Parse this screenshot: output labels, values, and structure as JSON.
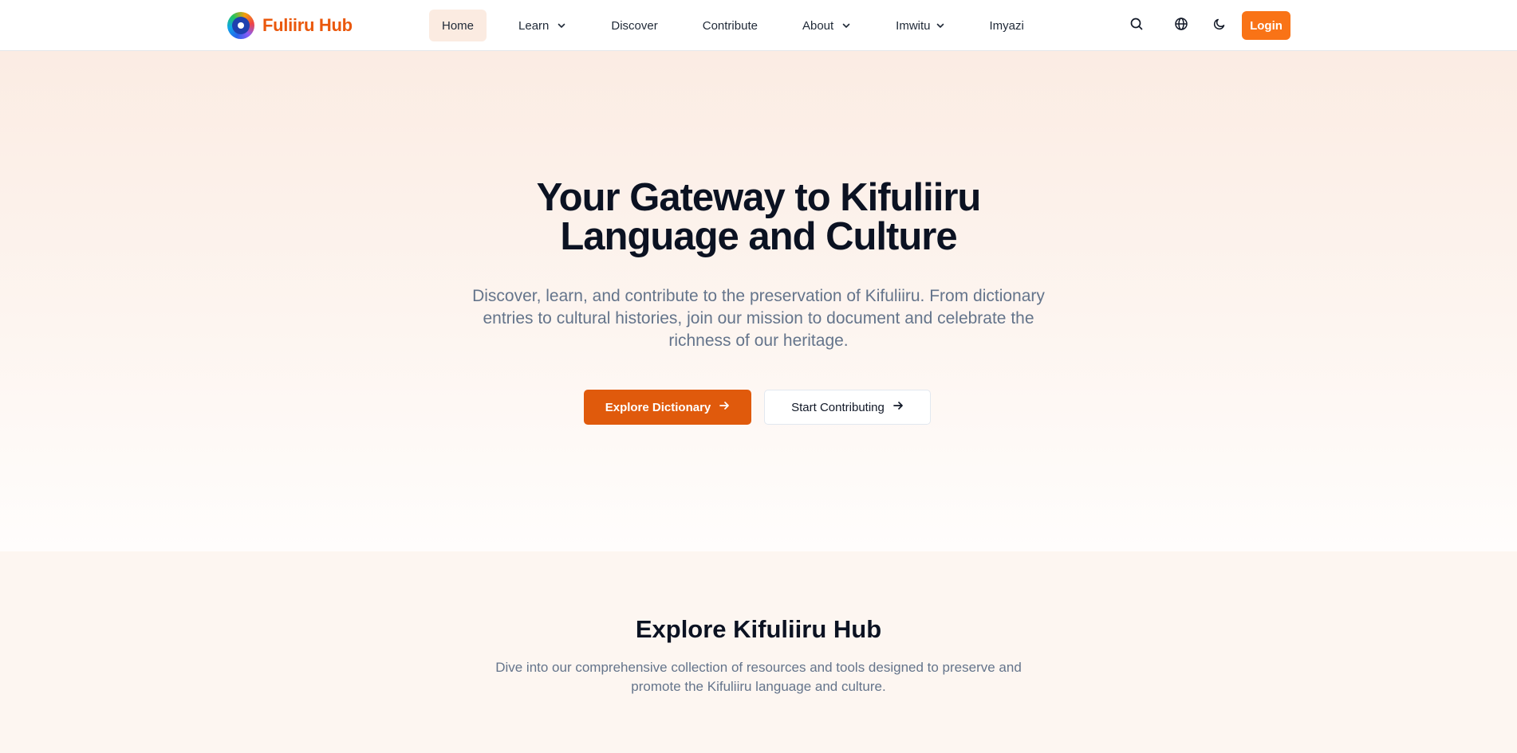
{
  "brand": {
    "name": "Fuliiru Hub"
  },
  "nav": {
    "items": [
      {
        "label": "Home",
        "active": true,
        "dropdown": false
      },
      {
        "label": "Learn",
        "active": false,
        "dropdown": true
      },
      {
        "label": "Discover",
        "active": false,
        "dropdown": false
      },
      {
        "label": "Contribute",
        "active": false,
        "dropdown": false
      },
      {
        "label": "About",
        "active": false,
        "dropdown": true
      },
      {
        "label": "Imwitu",
        "active": false,
        "dropdown": true
      },
      {
        "label": "Imyazi",
        "active": false,
        "dropdown": false
      }
    ]
  },
  "header_actions": {
    "icons": [
      "search-icon",
      "globe-icon",
      "moon-icon"
    ],
    "login_label": "Login"
  },
  "hero": {
    "title_line1": "Your Gateway to Kifuliiru",
    "title_line2": "Language and Culture",
    "subtitle": "Discover, learn, and contribute to the preservation of Kifuliiru. From dictionary entries to cultural histories, join our mission to document and celebrate the richness of our heritage.",
    "primary_button": "Explore Dictionary",
    "secondary_button": "Start Contributing"
  },
  "explore": {
    "title": "Explore Kifuliiru Hub",
    "subtitle": "Dive into our comprehensive collection of resources and tools designed to preserve and promote the Kifuliiru language and culture."
  },
  "colors": {
    "brand_orange": "#ea580c",
    "login_orange": "#f97316",
    "primary_button": "#e05a0c",
    "active_nav_bg": "#fbebe1"
  }
}
